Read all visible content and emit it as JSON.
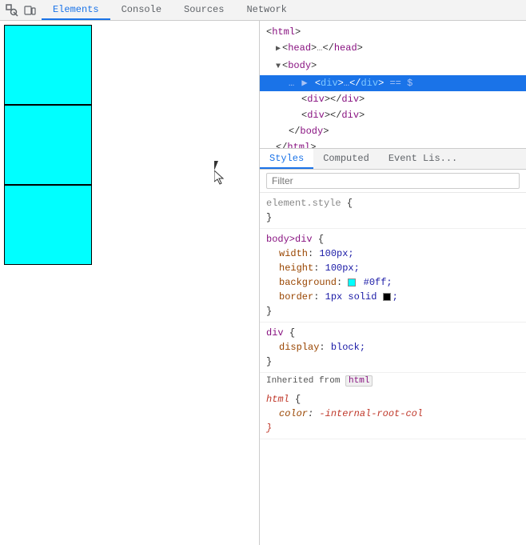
{
  "toolbar": {
    "icons": [
      "inspect",
      "device"
    ],
    "tabs": [
      "Elements",
      "Console",
      "Sources",
      "Network"
    ]
  },
  "preview": {
    "boxes": [
      {
        "bg": "#00ffff",
        "border": "#000"
      },
      {
        "bg": "#00ffff",
        "border": "#000"
      },
      {
        "bg": "#00ffff",
        "border": "#000"
      }
    ]
  },
  "panel": {
    "tabs": [
      "Styles",
      "Computed",
      "Event Listeners"
    ],
    "active_tab": "Styles"
  },
  "dom": {
    "lines": [
      {
        "text": "<html>",
        "indent": 0,
        "has_triangle": false,
        "selected": false
      },
      {
        "text": "▶ <head>…</head>",
        "indent": 1,
        "selected": false
      },
      {
        "text": "▼ <body>",
        "indent": 1,
        "selected": false
      },
      {
        "text": "… ▶ <div>…</div> == $",
        "indent": 2,
        "selected": true
      },
      {
        "text": "<div></div>",
        "indent": 3,
        "selected": false
      },
      {
        "text": "<div></div>",
        "indent": 3,
        "selected": false
      },
      {
        "text": "</body>",
        "indent": 2,
        "selected": false
      },
      {
        "text": "</html>",
        "indent": 1,
        "selected": false
      }
    ]
  },
  "styles": {
    "filter_placeholder": "Filter",
    "element_style": {
      "selector": "element.style",
      "rules": []
    },
    "body_div": {
      "selector": "body>div",
      "rules": [
        {
          "property": "width",
          "value": "100px;"
        },
        {
          "property": "height",
          "value": "100px;"
        },
        {
          "property": "background",
          "value": "#0ff;",
          "has_swatch": true,
          "swatch_color": "#00ffff"
        },
        {
          "property": "border",
          "value": "1px solid",
          "has_swatch": false,
          "extra": "black_swatch"
        }
      ]
    },
    "div_rule": {
      "selector": "div",
      "rules": [
        {
          "property": "display",
          "value": "block;"
        }
      ]
    },
    "inherited_from": "html",
    "html_rule": {
      "selector": "html",
      "rules": [
        {
          "property": "color",
          "value": "-internal-root-col"
        }
      ]
    }
  }
}
